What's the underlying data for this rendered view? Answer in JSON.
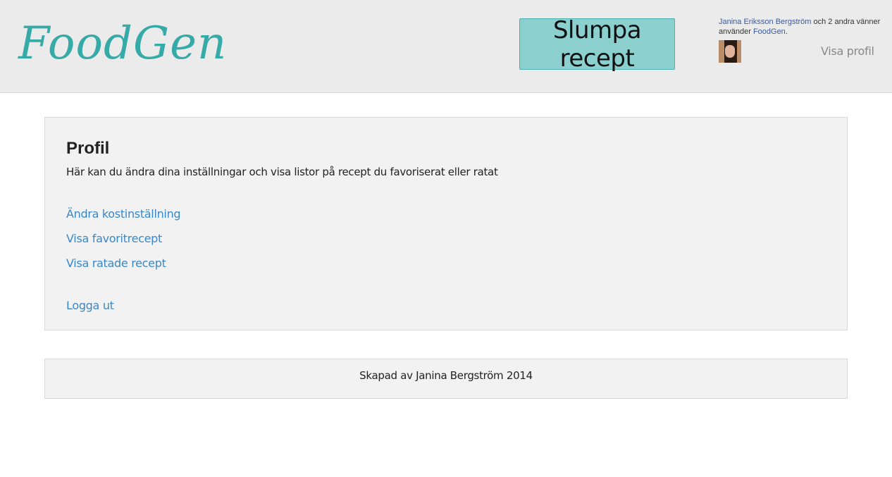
{
  "header": {
    "logo": "FoodGen",
    "random_button": "Slumpa recept",
    "social": {
      "friend_name": "Janina Eriksson Bergström",
      "middle_text": " och 2 andra vänner använder ",
      "app_name": "FoodGen",
      "end": "."
    },
    "view_profile": "Visa profil"
  },
  "profile": {
    "title": "Profil",
    "description": "Här kan du ändra dina inställningar och visa listor på recept du favoriserat eller ratat",
    "links": {
      "diet_settings": "Ändra kostinställning",
      "favorites": "Visa favoritrecept",
      "rejected": "Visa ratade recept",
      "logout": "Logga ut"
    }
  },
  "footer": {
    "text": "Skapad av Janina Bergström 2014"
  }
}
